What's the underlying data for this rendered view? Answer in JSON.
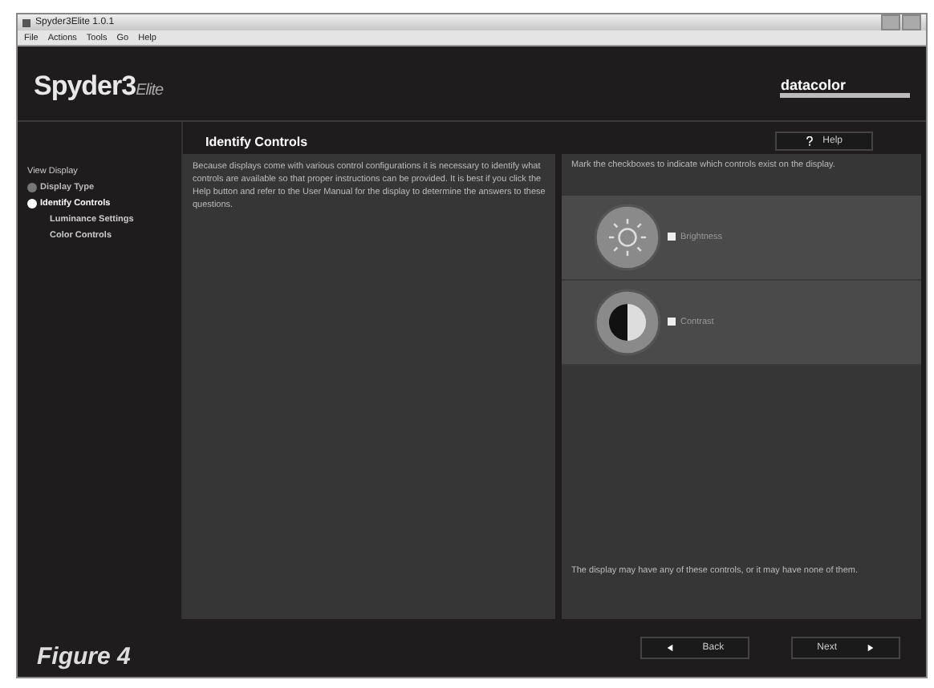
{
  "window": {
    "title": "Spyder3Elite 1.0.1"
  },
  "menu": [
    "File",
    "Actions",
    "Tools",
    "Go",
    "Help"
  ],
  "logo": {
    "name": "Spyder3",
    "suffix": "Elite",
    "brand": "datacolor"
  },
  "sidebar": {
    "heading": "View Display",
    "items": [
      {
        "label": "Display Type",
        "kind": "radio",
        "selected": false
      },
      {
        "label": "Identify Controls",
        "kind": "radio",
        "selected": true
      },
      {
        "label": "Luminance Settings",
        "kind": "sub"
      },
      {
        "label": "Color Controls",
        "kind": "sub"
      }
    ]
  },
  "page": {
    "title": "Identify Controls",
    "help_button": "Help",
    "description": "Because displays come with various control configurations it is necessary to identify what controls are available so that proper instructions can be provided. It is best if you click the Help button and refer to the User Manual for the display to determine the answers to these questions.",
    "instruction": "Mark the checkboxes to indicate which controls exist on the display.",
    "controls": [
      {
        "label": "Brightness",
        "kind": "brightness",
        "checked": false
      },
      {
        "label": "Contrast",
        "kind": "contrast",
        "checked": false
      }
    ],
    "note": "The display may have any of these controls, or it may have none of them."
  },
  "buttons": {
    "back": "Back",
    "next": "Next"
  },
  "caption": "Figure 4"
}
